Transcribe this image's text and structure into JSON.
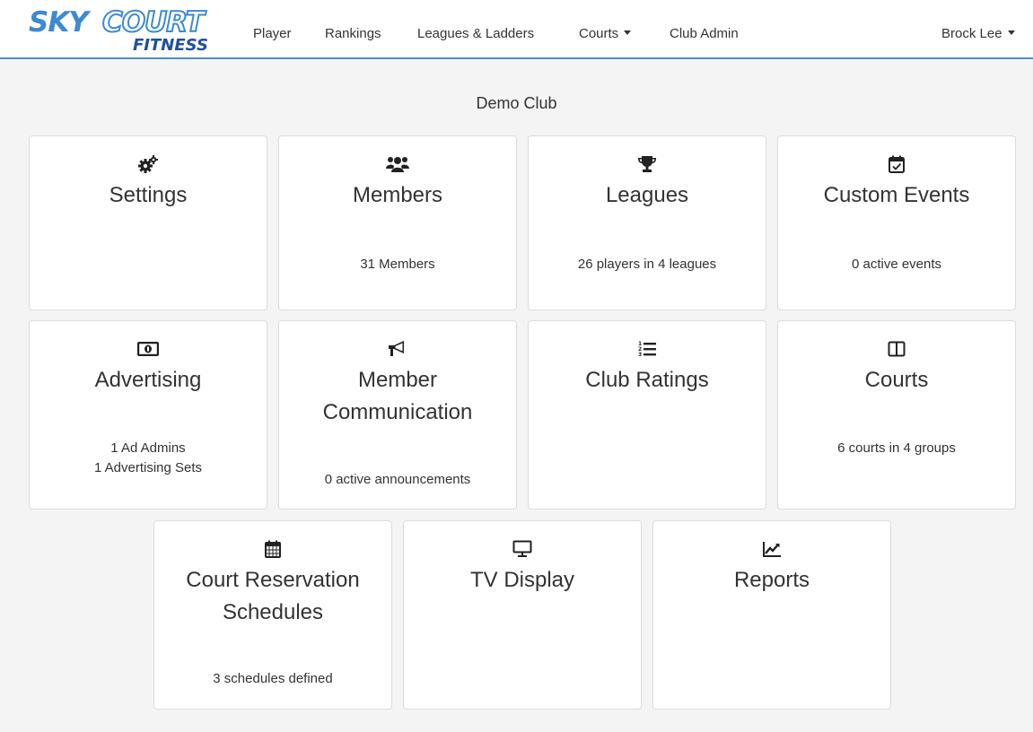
{
  "brand": {
    "sky": "SKY",
    "court": "COURT",
    "fitness": "FITNESS"
  },
  "nav": {
    "player": "Player",
    "rankings": "Rankings",
    "leagues_ladders": "Leagues & Ladders",
    "courts": "Courts",
    "club_admin": "Club Admin",
    "user": "Brock Lee"
  },
  "page": {
    "title": "Demo Club"
  },
  "cards": {
    "settings": {
      "title": "Settings",
      "icon": "gears-icon"
    },
    "members": {
      "title": "Members",
      "sub": "31 Members",
      "icon": "users-icon"
    },
    "leagues": {
      "title": "Leagues",
      "sub": "26 players in 4 leagues",
      "icon": "trophy-icon"
    },
    "custom_events": {
      "title": "Custom Events",
      "sub": "0 active events",
      "icon": "calendar-check-icon"
    },
    "advertising": {
      "title": "Advertising",
      "sub1": "1 Ad Admins",
      "sub2": "1 Advertising Sets",
      "icon": "money-bill-icon"
    },
    "member_communication": {
      "title_line1": "Member",
      "title_line2": "Communication",
      "sub": "0 active announcements",
      "icon": "bullhorn-icon"
    },
    "club_ratings": {
      "title": "Club Ratings",
      "icon": "ordered-list-icon"
    },
    "courts": {
      "title": "Courts",
      "sub": "6 courts in 4 groups",
      "icon": "columns-icon"
    },
    "court_reservation_schedules": {
      "title_line1": "Court Reservation",
      "title_line2": "Schedules",
      "sub": "3 schedules defined",
      "icon": "calendar-icon"
    },
    "tv_display": {
      "title": "TV Display",
      "icon": "monitor-icon"
    },
    "reports": {
      "title": "Reports",
      "icon": "line-chart-icon"
    }
  },
  "colors": {
    "accent": "#4a8dc4",
    "logo_blue": "#3d8ad0",
    "logo_dark": "#1f4fa0",
    "background": "#f4f4f4"
  }
}
